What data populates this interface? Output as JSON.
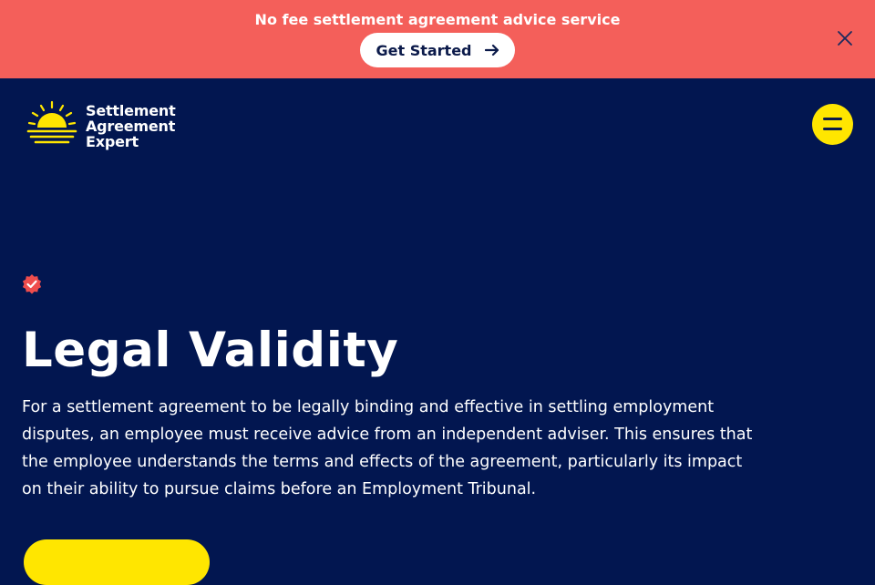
{
  "banner": {
    "text": "No fee settlement agreement advice service",
    "button_label": "Get Started",
    "button_icon": "arrow-right-icon",
    "close_icon": "close-icon",
    "background": "#f45f5a"
  },
  "header": {
    "logo": {
      "icon": "sunrise-logo-icon",
      "line1": "Settlement",
      "line2": "Agreement",
      "line3": "Expert"
    },
    "menu_icon": "hamburger-menu-icon",
    "menu_color": "#ffe600"
  },
  "main": {
    "badge_icon": "verified-check-icon",
    "title": "Legal Validity",
    "body": "For a settlement agreement to be legally binding and effective in settling employment disputes, an employee must receive advice from an independent adviser. This ensures that the employee understands the terms and effects of the agreement, particularly its impact on their ability to pursue claims before an Employment Tribunal.",
    "background": "#021650"
  }
}
